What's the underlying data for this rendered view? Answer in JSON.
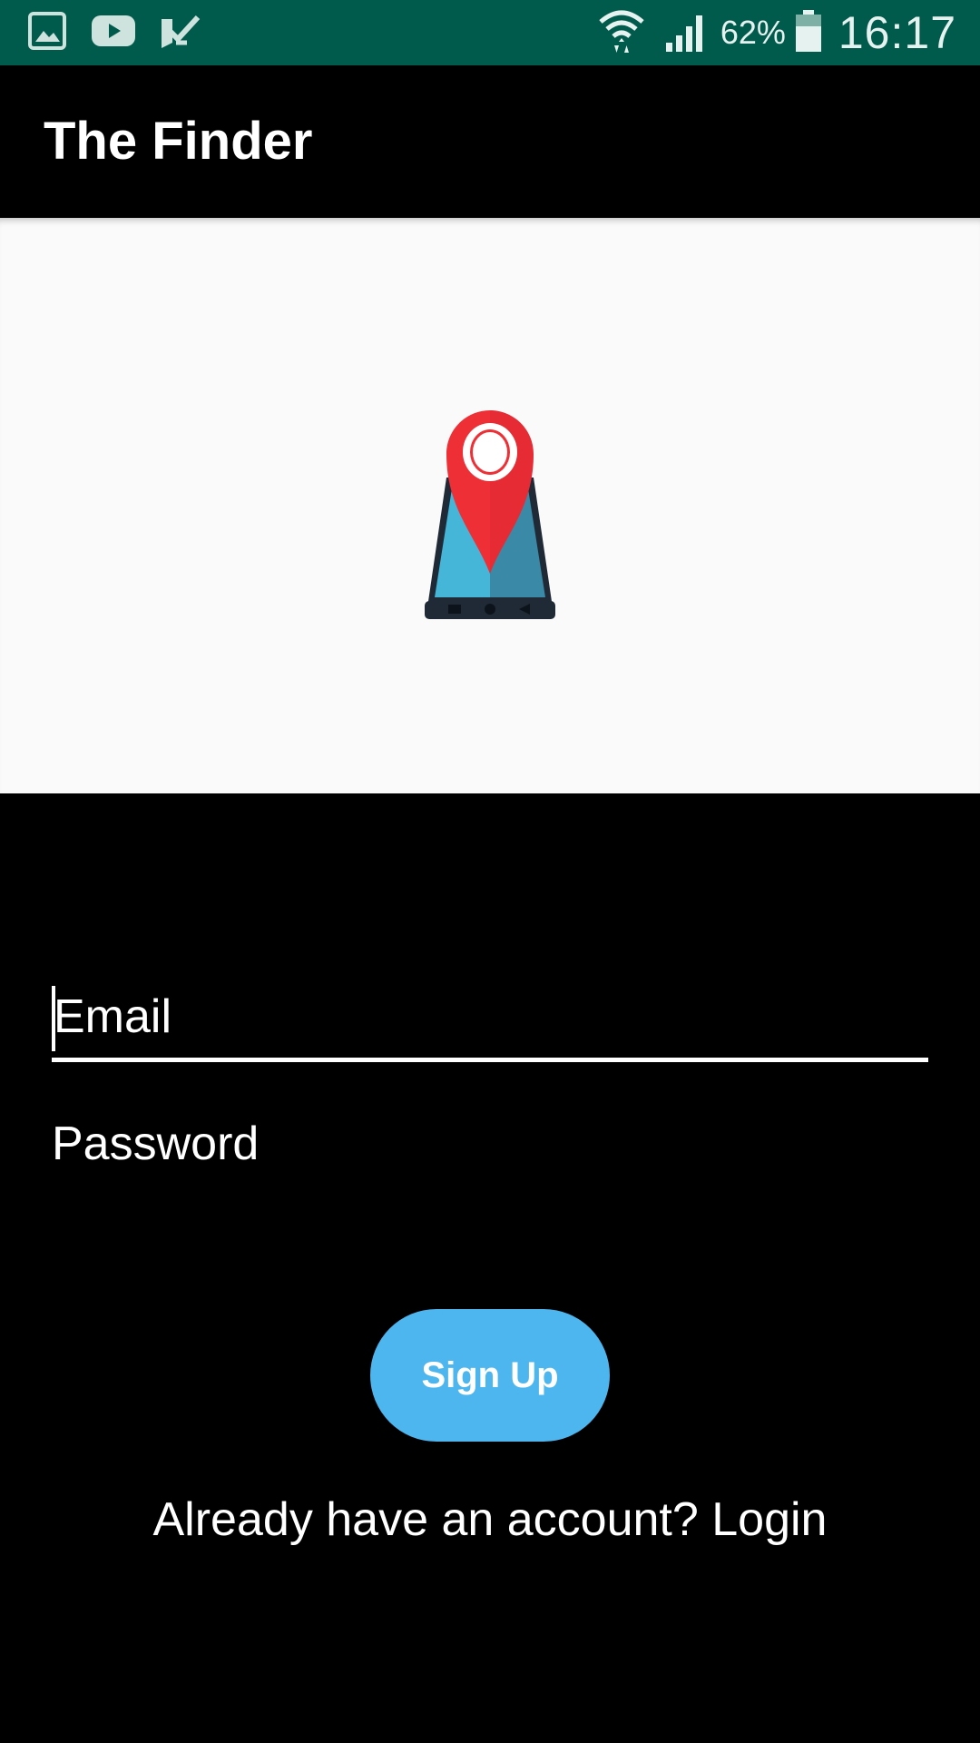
{
  "status_bar": {
    "left_icons": [
      "gallery-icon",
      "youtube-icon",
      "checkmark-notification-icon"
    ],
    "right_icons": [
      "wifi-icon",
      "signal-icon",
      "battery-icon"
    ],
    "battery_percent": "62%",
    "time": "16:17",
    "background_color": "#015b4d"
  },
  "app_bar": {
    "title": "The Finder"
  },
  "hero": {
    "logo": "location-pin-on-phone-icon",
    "background_color": "#fafafa",
    "pin_color": "#ee2f36",
    "screen_color": "#45b5d8"
  },
  "form": {
    "email_placeholder": "Email",
    "password_placeholder": "Password",
    "signup_label": "Sign Up",
    "signup_color": "#4db6ee",
    "login_prompt": "Already have an account? Login"
  }
}
